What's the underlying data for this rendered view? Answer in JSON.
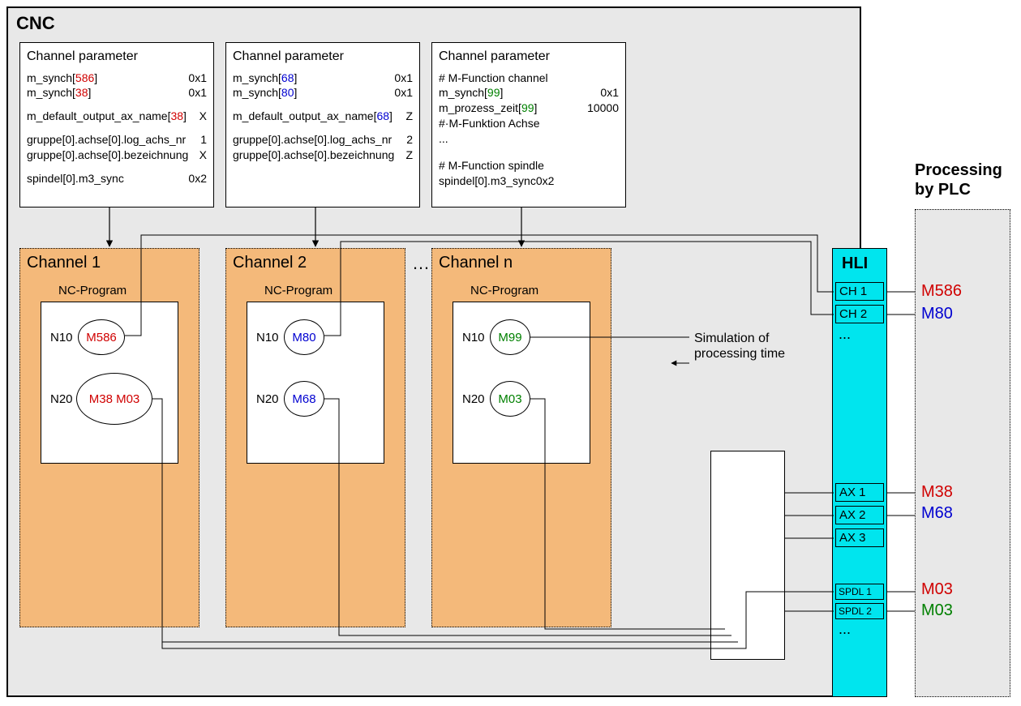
{
  "cnc": {
    "title": "CNC"
  },
  "params": {
    "p1": {
      "title": "Channel parameter",
      "l1a": "m_synch[",
      "l1b": "586",
      "l1c": "]",
      "l1v": "0x1",
      "l2a": "m_synch[",
      "l2b": "38",
      "l2c": "]",
      "l2v": "0x1",
      "l3a": "m_default_output_ax_name[",
      "l3b": "38",
      "l3c": "]",
      "l3v": "X",
      "l4": "gruppe[0].achse[0].log_achs_nr",
      "l4v": "1",
      "l5": "gruppe[0].achse[0].bezeichnung",
      "l5v": "X",
      "l6": "spindel[0].m3_sync",
      "l6v": "0x2"
    },
    "p2": {
      "title": "Channel parameter",
      "l1a": "m_synch[",
      "l1b": "68",
      "l1c": "]",
      "l1v": "0x1",
      "l2a": "m_synch[",
      "l2b": "80",
      "l2c": "]",
      "l2v": "0x1",
      "l3a": "m_default_output_ax_name[",
      "l3b": "68",
      "l3c": "]",
      "l3v": "Z",
      "l4": "gruppe[0].achse[0].log_achs_nr",
      "l4v": "2",
      "l5": "gruppe[0].achse[0].bezeichnung",
      "l5v": "Z"
    },
    "p3": {
      "title": "Channel parameter",
      "c1": "# M-Function channel",
      "l1a": "m_synch[",
      "l1b": "99",
      "l1c": "]",
      "l1v": "0x1",
      "l2a": "m_prozess_zeit[",
      "l2b": "99",
      "l2c": "]",
      "l2v": "10000",
      "c2": "#·M-Funktion Achse",
      "dots": "...",
      "c3": "# M-Function spindle",
      "l3": "spindel[0].m3_sync0x2"
    }
  },
  "channels": {
    "c1": {
      "title": "Channel 1"
    },
    "c2": {
      "title": "Channel 2"
    },
    "cn": {
      "title": "Channel n"
    },
    "ellipsis": "…"
  },
  "nc": {
    "title": "NC-Program",
    "n10": "N10",
    "n20": "N20",
    "m586": "M586",
    "m38m03": "M38 M03",
    "m80": "M80",
    "m68": "M68",
    "m99": "M99",
    "m03": "M03"
  },
  "sim": {
    "l1": "Simulation of",
    "l2": "processing time"
  },
  "hli": {
    "title": "HLI",
    "ch1": "CH 1",
    "ch2": "CH 2",
    "ax1": "AX 1",
    "ax2": "AX 2",
    "ax3": "AX 3",
    "sp1": "SPDL 1",
    "sp2": "SPDL 2",
    "dots": "..."
  },
  "plc": {
    "l1": "Processing",
    "l2": "by PLC"
  },
  "out": {
    "m586": "M586",
    "m80": "M80",
    "m38": "M38",
    "m68": "M68",
    "m03a": "M03",
    "m03b": "M03"
  }
}
